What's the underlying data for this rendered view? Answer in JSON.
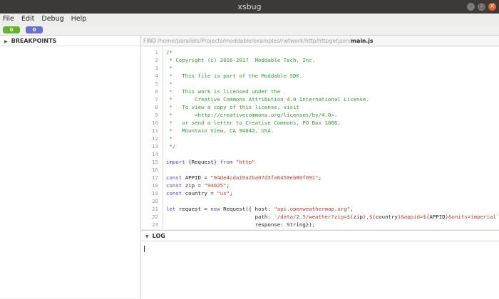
{
  "window": {
    "title": "xsbug",
    "controls": [
      "minimize-icon",
      "maximize-icon",
      "close-icon"
    ]
  },
  "menu": [
    "File",
    "Edit",
    "Debug",
    "Help"
  ],
  "toolbar": {
    "green_count": "0",
    "blue_count": "0"
  },
  "breakpoints": {
    "label": "BREAKPOINTS"
  },
  "pathbar": {
    "find_label": "FIND",
    "dir": "/home/parallels/Projects/moddable/examples/network/http/httpgetjson/",
    "file": "main.js"
  },
  "code_lines": [
    {
      "n": "1",
      "parts": [
        {
          "t": "/*",
          "c": "c"
        }
      ]
    },
    {
      "n": "2",
      "parts": [
        {
          "t": " * Copyright (c) 2016-2017  Moddable Tech, Inc.",
          "c": "c"
        }
      ]
    },
    {
      "n": "3",
      "parts": [
        {
          "t": " *",
          "c": "c"
        }
      ]
    },
    {
      "n": "4",
      "parts": [
        {
          "t": " *   This file is part of the Moddable SDK.",
          "c": "c"
        }
      ]
    },
    {
      "n": "5",
      "parts": [
        {
          "t": " *",
          "c": "c"
        }
      ]
    },
    {
      "n": "6",
      "parts": [
        {
          "t": " *   This work is licensed under the",
          "c": "c"
        }
      ]
    },
    {
      "n": "7",
      "parts": [
        {
          "t": " *       Creative Commons Attribution 4.0 International License.",
          "c": "c"
        }
      ]
    },
    {
      "n": "8",
      "parts": [
        {
          "t": " *   To view a copy of this license, visit",
          "c": "c"
        }
      ]
    },
    {
      "n": "9",
      "parts": [
        {
          "t": " *       <http://creativecommons.org/licenses/by/4.0>.",
          "c": "c"
        }
      ]
    },
    {
      "n": "10",
      "parts": [
        {
          "t": " *   or send a letter to Creative Commons, PO Box 1866,",
          "c": "c"
        }
      ]
    },
    {
      "n": "11",
      "parts": [
        {
          "t": " *   Mountain View, CA 94042, USA.",
          "c": "c"
        }
      ]
    },
    {
      "n": "12",
      "parts": [
        {
          "t": " *",
          "c": "c"
        }
      ]
    },
    {
      "n": "13",
      "parts": [
        {
          "t": " */",
          "c": "c"
        }
      ]
    },
    {
      "n": "14",
      "parts": []
    },
    {
      "n": "15",
      "parts": [
        {
          "t": "import",
          "c": "k"
        },
        {
          "t": " {Request} ",
          "c": ""
        },
        {
          "t": "from",
          "c": "k"
        },
        {
          "t": " ",
          "c": ""
        },
        {
          "t": "\"http\"",
          "c": "s"
        }
      ]
    },
    {
      "n": "16",
      "parts": []
    },
    {
      "n": "17",
      "parts": [
        {
          "t": "const",
          "c": "k"
        },
        {
          "t": " APPID = ",
          "c": ""
        },
        {
          "t": "\"94de4cda19a2ba07d3fa6450eb80f091\"",
          "c": "s"
        },
        {
          "t": ";",
          "c": ""
        }
      ]
    },
    {
      "n": "18",
      "parts": [
        {
          "t": "const",
          "c": "k"
        },
        {
          "t": " zip = ",
          "c": ""
        },
        {
          "t": "\"94025\"",
          "c": "s"
        },
        {
          "t": ";",
          "c": ""
        }
      ]
    },
    {
      "n": "19",
      "parts": [
        {
          "t": "const",
          "c": "k"
        },
        {
          "t": " country = ",
          "c": ""
        },
        {
          "t": "\"us\"",
          "c": "s"
        },
        {
          "t": ";",
          "c": ""
        }
      ]
    },
    {
      "n": "20",
      "parts": []
    },
    {
      "n": "21",
      "parts": [
        {
          "t": "let",
          "c": "k"
        },
        {
          "t": " request = ",
          "c": ""
        },
        {
          "t": "new",
          "c": "k"
        },
        {
          "t": " Request({ host: ",
          "c": ""
        },
        {
          "t": "\"api.openweathermap.org\"",
          "c": "s"
        },
        {
          "t": ",",
          "c": ""
        }
      ]
    },
    {
      "n": "22",
      "parts": [
        {
          "t": "                            path: ",
          "c": ""
        },
        {
          "t": "`/data/2.5/weather?zip=${",
          "c": "s"
        },
        {
          "t": "zip",
          "c": ""
        },
        {
          "t": "},${",
          "c": "s"
        },
        {
          "t": "country",
          "c": ""
        },
        {
          "t": "}&appid=${",
          "c": "s"
        },
        {
          "t": "APPID",
          "c": ""
        },
        {
          "t": "}&units=imperial`",
          "c": "s"
        },
        {
          "t": ",",
          "c": ""
        }
      ]
    },
    {
      "n": "23",
      "parts": [
        {
          "t": "                            response: String});",
          "c": ""
        }
      ]
    }
  ],
  "log": {
    "label": "LOG"
  }
}
